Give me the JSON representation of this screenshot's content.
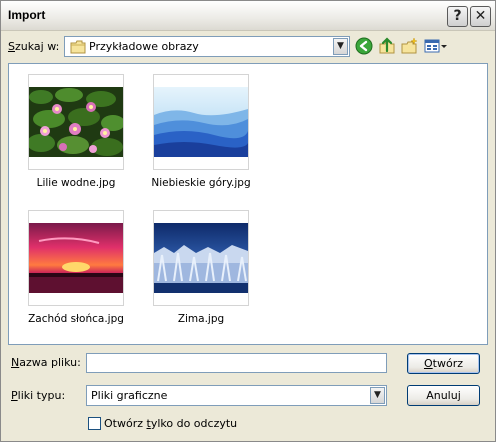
{
  "window": {
    "title": "Import",
    "help_label": "?",
    "close_label": "✕"
  },
  "lookin": {
    "label_prefix": "S",
    "label_rest": "zukaj w:",
    "value": "Przykładowe obrazy"
  },
  "toolbar": {
    "icons": [
      "back-icon",
      "up-folder-icon",
      "new-folder-icon",
      "view-menu-icon"
    ]
  },
  "files": [
    {
      "name": "Lilie wodne.jpg"
    },
    {
      "name": "Niebieskie góry.jpg"
    },
    {
      "name": "Zachód słońca.jpg"
    },
    {
      "name": "Zima.jpg"
    }
  ],
  "filename": {
    "label_prefix": "N",
    "label_rest": "azwa pliku:",
    "value": ""
  },
  "filetype": {
    "label_prefix": "P",
    "label_rest": "liki typu:",
    "value": "Pliki graficzne"
  },
  "buttons": {
    "open_prefix": "O",
    "open_rest": "twórz",
    "cancel": "Anuluj"
  },
  "readonly": {
    "label_pre": "Otwórz ",
    "label_u": "t",
    "label_post": "ylko do odczytu"
  },
  "colors": {
    "dialog_bg": "#ece9d8",
    "input_border": "#7f9db9",
    "button_border": "#003c74"
  }
}
